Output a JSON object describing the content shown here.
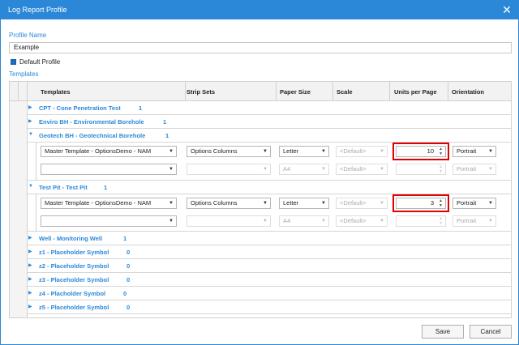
{
  "window": {
    "title": "Log Report Profile"
  },
  "profile": {
    "name_label": "Profile Name",
    "name_value": "Example",
    "default_label": "Default Profile"
  },
  "templates_label": "Templates",
  "columns": [
    "Templates",
    "Strip Sets",
    "Paper Size",
    "Scale",
    "Units per Page",
    "Orientation"
  ],
  "groups": [
    {
      "name": "CPT - Cone Penetration Test",
      "count": "1"
    },
    {
      "name": "Enviro BH - Environmental Borehole",
      "count": "1"
    },
    {
      "name": "Geotech BH - Geotechnical Borehole",
      "count": "1"
    },
    {
      "name": "Test Pit - Test Pit",
      "count": "1"
    },
    {
      "name": "Well - Monitoring Well",
      "count": "1"
    },
    {
      "name": "z1 - Placeholder Symbol",
      "count": "0"
    },
    {
      "name": "z2 - Placeholder Symbol",
      "count": "0"
    },
    {
      "name": "z3 - Placeholder Symbol",
      "count": "0"
    },
    {
      "name": "z4 - Placholder Symbol",
      "count": "0"
    },
    {
      "name": "z5 - Placeholder Symbol",
      "count": "0"
    }
  ],
  "geotech": {
    "row1": {
      "template": "Master Template - OptionsDemo - NAM",
      "strip": "Options Columns",
      "paper": "Letter",
      "scale": "<Default>",
      "units": "10",
      "orient": "Portrait"
    },
    "row2": {
      "paper": "A4",
      "scale": "<Default>",
      "orient": "Portrait"
    }
  },
  "testpit": {
    "row1": {
      "template": "Master Template - OptionsDemo - NAM",
      "strip": "Options Columns",
      "paper": "Letter",
      "scale": "<Default>",
      "units": "3",
      "orient": "Portrait"
    },
    "row2": {
      "paper": "A4",
      "scale": "<Default>",
      "orient": "Portrait"
    }
  },
  "buttons": {
    "save": "Save",
    "cancel": "Cancel"
  },
  "icons": {
    "close": "close-icon",
    "expand": "triangle-right-icon",
    "collapse": "triangle-down-icon",
    "dropdown": "chevron-down-icon",
    "spin": "spin-arrows-icon"
  }
}
